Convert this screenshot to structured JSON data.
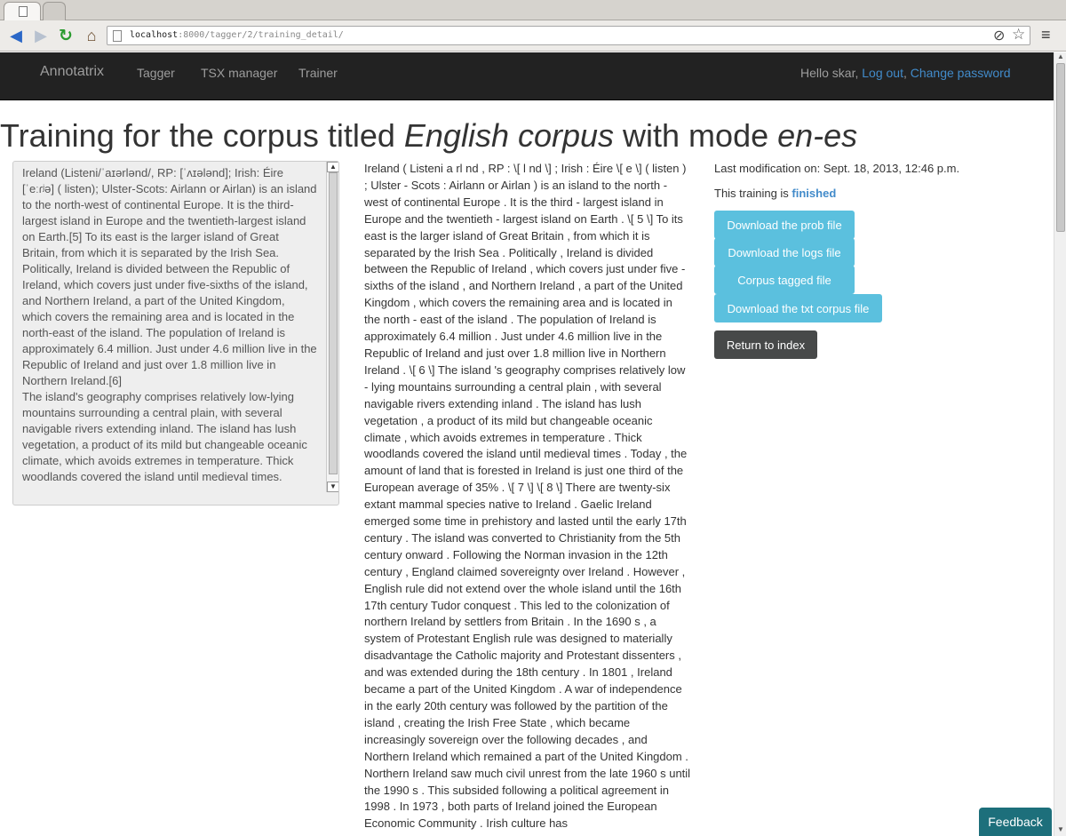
{
  "browser": {
    "url_host": "localhost",
    "url_rest": ":8000/tagger/2/training_detail/"
  },
  "navbar": {
    "brand": "Annotatrix",
    "links": [
      "Tagger",
      "TSX manager",
      "Trainer"
    ],
    "greeting": "Hello skar, ",
    "logout": "Log out",
    "sep": ", ",
    "change_password": "Change password"
  },
  "title": {
    "prefix": "Training for the corpus titled ",
    "corpus": "English corpus",
    "middle": " with mode ",
    "mode": "en-es"
  },
  "original_text": "Ireland (Listeni/ˈaɪərlənd/, RP: [ˈʌɪələnd]; Irish: Éire [ˈeːɾʲə] ( listen); Ulster-Scots: Airlann or Airlan) is an island to the north-west of continental Europe. It is the third-largest island in Europe and the twentieth-largest island on Earth.[5] To its east is the larger island of Great Britain, from which it is separated by the Irish Sea.\nPolitically, Ireland is divided between the Republic of Ireland, which covers just under five-sixths of the island, and Northern Ireland, a part of the United Kingdom, which covers the remaining area and is located in the north-east of the island. The population of Ireland is approximately 6.4 million. Just under 4.6 million live in the Republic of Ireland and just over 1.8 million live in Northern Ireland.[6]\nThe island's geography comprises relatively low-lying mountains surrounding a central plain, with several navigable rivers extending inland. The island has lush vegetation, a product of its mild but changeable oceanic climate, which avoids extremes in temperature. Thick woodlands covered the island until medieval times.",
  "tagged_text": "Ireland ( Listeni a rl nd , RP : \\[ l nd \\] ; Irish : Éire \\[ e \\] ( listen ) ; Ulster - Scots : Airlann or Airlan ) is an island to the north - west of continental Europe . It is the third - largest island in Europe and the twentieth - largest island on Earth . \\[ 5 \\] To its east is the larger island of Great Britain , from which it is separated by the Irish Sea . Politically , Ireland is divided between the Republic of Ireland , which covers just under five - sixths of the island , and Northern Ireland , a part of the United Kingdom , which covers the remaining area and is located in the north - east of the island . The population of Ireland is approximately 6.4 million . Just under 4.6 million live in the Republic of Ireland and just over 1.8 million live in Northern Ireland . \\[ 6 \\] The island 's geography comprises relatively low - lying mountains surrounding a central plain , with several navigable rivers extending inland . The island has lush vegetation , a product of its mild but changeable oceanic climate , which avoids extremes in temperature . Thick woodlands covered the island until medieval times . Today , the amount of land that is forested in Ireland is just one third of the European average of 35% . \\[ 7 \\] \\[ 8 \\] There are twenty-six extant mammal species native to Ireland . Gaelic Ireland emerged some time in prehistory and lasted until the early 17th century . The island was converted to Christianity from the 5th century onward . Following the Norman invasion in the 12th century , England claimed sovereignty over Ireland . However , English rule did not extend over the whole island until the 16th 17th century Tudor conquest . This led to the colonization of northern Ireland by settlers from Britain . In the 1690 s , a system of Protestant English rule was designed to materially disadvantage the Catholic majority and Protestant dissenters , and was extended during the 18th century . In 1801 , Ireland became a part of the United Kingdom . A war of independence in the early 20th century was followed by the partition of the island , creating the Irish Free State , which became increasingly sovereign over the following decades , and Northern Ireland which remained a part of the United Kingdom . Northern Ireland saw much civil unrest from the late 1960 s until the 1990 s . This subsided following a political agreement in 1998 . In 1973 , both parts of Ireland joined the European Economic Community . Irish culture has",
  "sidebar": {
    "last_modification": "Last modification on: Sept. 18, 2013, 12:46 p.m.",
    "status_prefix": "This training is ",
    "status_value": "finished",
    "buttons": {
      "prob": "Download the prob file",
      "logs": "Download the logs file",
      "tagged": "Corpus tagged file",
      "txt": "Download the txt corpus file",
      "index": "Return to index"
    }
  },
  "feedback": "Feedback",
  "colors": {
    "navbar_bg": "#222222",
    "link": "#428bca",
    "btn_info": "#5bc0de",
    "btn_dark": "#474949",
    "feedback_bg": "#1d6f7b"
  }
}
